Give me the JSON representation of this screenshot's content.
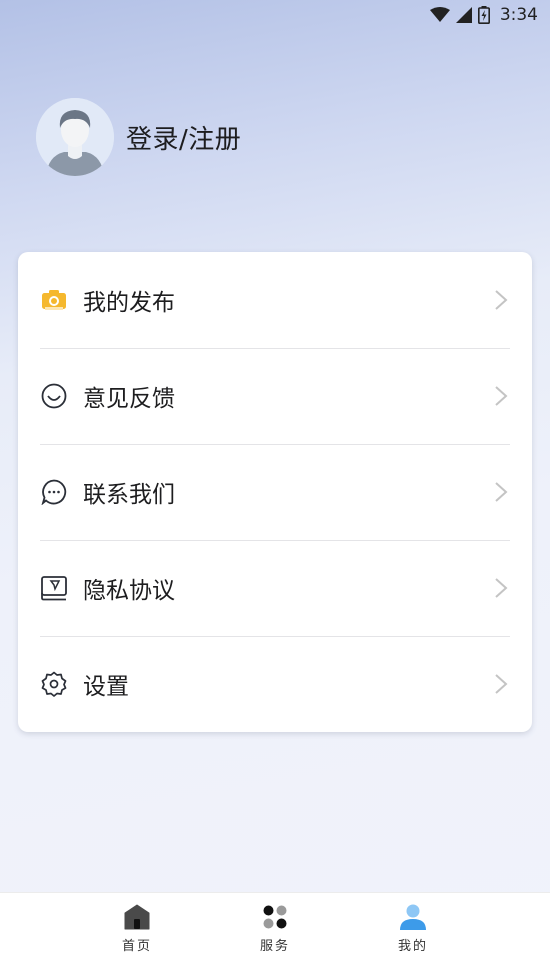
{
  "status_bar": {
    "time": "3:34",
    "icons": [
      "wifi-icon",
      "signal-icon",
      "battery-icon"
    ]
  },
  "profile": {
    "login_label": "登录/注册",
    "avatar_icon": "user-avatar-icon"
  },
  "menu": [
    {
      "label": "我的发布",
      "icon": "camera-icon"
    },
    {
      "label": "意见反馈",
      "icon": "smile-icon"
    },
    {
      "label": "联系我们",
      "icon": "chat-bubble-icon"
    },
    {
      "label": "隐私协议",
      "icon": "document-icon"
    },
    {
      "label": "设置",
      "icon": "gear-icon"
    }
  ],
  "bottom_nav": [
    {
      "label": "首页",
      "icon": "home-icon"
    },
    {
      "label": "服务",
      "icon": "grid-dots-icon"
    },
    {
      "label": "我的",
      "icon": "person-icon",
      "active": true
    }
  ],
  "colors": {
    "accent_blue": "#3d9be9",
    "camera_yellow": "#f5b82e"
  }
}
